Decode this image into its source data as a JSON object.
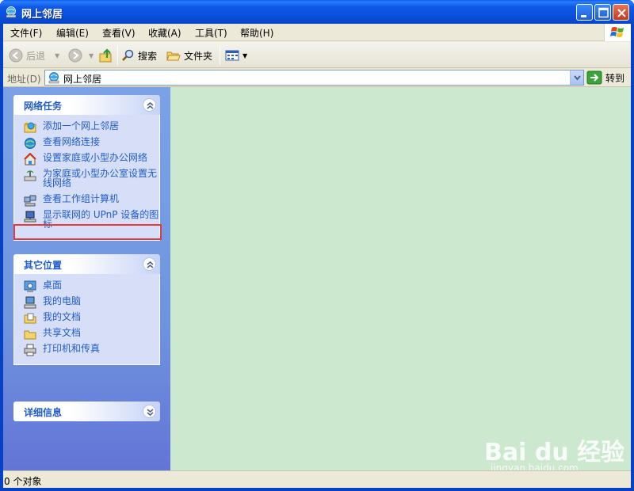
{
  "window": {
    "title": "网上邻居"
  },
  "menu": [
    "文件(F)",
    "编辑(E)",
    "查看(V)",
    "收藏(A)",
    "工具(T)",
    "帮助(H)"
  ],
  "toolbar": {
    "back": "后退",
    "search": "搜索",
    "folders": "文件夹"
  },
  "address": {
    "label": "地址(D)",
    "value": "网上邻居",
    "go": "转到"
  },
  "panels": {
    "network_tasks": {
      "title": "网络任务",
      "items": [
        "添加一个网上邻居",
        "查看网络连接",
        "设置家庭或小型办公网络",
        "为家庭或小型办公室设置无线网络",
        "查看工作组计算机",
        "显示联网的 UPnP 设备的图标"
      ]
    },
    "other_places": {
      "title": "其它位置",
      "items": [
        "桌面",
        "我的电脑",
        "我的文档",
        "共享文档",
        "打印机和传真"
      ]
    },
    "details": {
      "title": "详细信息"
    }
  },
  "status": {
    "text": "0 个对象"
  },
  "watermark": {
    "brand": "Bai du 经验",
    "url": "jingyan.baidu.com"
  },
  "colors": {
    "title_blue": "#0a4fd9",
    "link_blue": "#215dc6",
    "content_bg": "#cce8cf",
    "highlight": "#e53a3a"
  }
}
